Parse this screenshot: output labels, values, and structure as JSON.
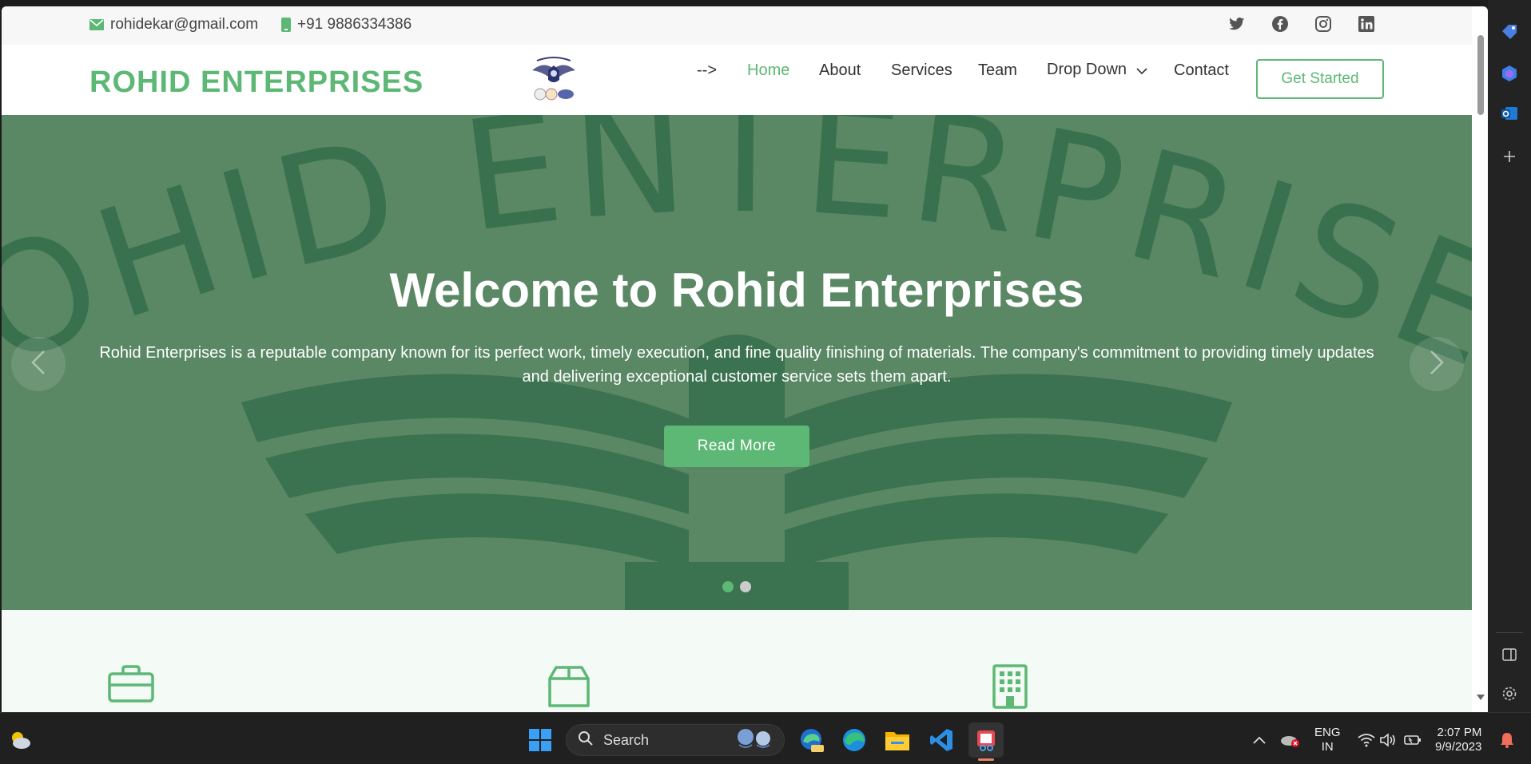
{
  "topbar": {
    "email": "rohidekar@gmail.com",
    "phone": "+91 9886334386",
    "social": [
      "twitter-icon",
      "facebook-icon",
      "instagram-icon",
      "linkedin-icon"
    ]
  },
  "header": {
    "brand": "ROHID ENTERPRISES",
    "nav": [
      {
        "label": "-->"
      },
      {
        "label": "Home"
      },
      {
        "label": "About"
      },
      {
        "label": "Services"
      },
      {
        "label": "Team"
      },
      {
        "label": "Drop Down"
      },
      {
        "label": "Contact"
      }
    ],
    "cta": "Get Started"
  },
  "hero": {
    "watermark": "ROHID ENTERPRISES",
    "title": "Welcome to Rohid Enterprises",
    "text": "Rohid Enterprises is a reputable company known for its perfect work, timely execution, and fine quality finishing of materials. The company's commitment to providing timely updates and delivering exceptional customer service sets them apart.",
    "button": "Read More",
    "slides": 2,
    "active_slide": 1
  },
  "features": {
    "icons": [
      "briefcase-icon",
      "box-icon",
      "building-icon"
    ]
  },
  "taskbar": {
    "search_placeholder": "Search",
    "lang_line1": "ENG",
    "lang_line2": "IN",
    "time": "2:07 PM",
    "date": "9/9/2023"
  },
  "colors": {
    "accent": "#5cb874",
    "hero_bg": "#5a8864",
    "watermark": "#2f6a48"
  }
}
